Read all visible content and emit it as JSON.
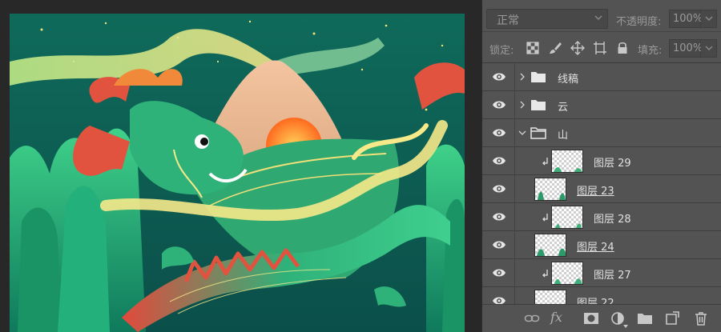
{
  "layers_panel": {
    "blend_mode": "正常",
    "opacity_label": "不透明度:",
    "opacity_value": "100%",
    "lock_label": "锁定:",
    "fill_label": "填充:",
    "fill_value": "100%",
    "fx_label": "fx",
    "layers": [
      {
        "name": "线稿",
        "kind": "group",
        "expanded": false
      },
      {
        "name": "云",
        "kind": "group",
        "expanded": false
      },
      {
        "name": "山",
        "kind": "group",
        "expanded": true
      },
      {
        "name": "图层 29",
        "kind": "layer",
        "clipped": true
      },
      {
        "name": "图层 23",
        "kind": "layer",
        "clipped": false
      },
      {
        "name": "图层 28",
        "kind": "layer",
        "clipped": true
      },
      {
        "name": "图层 24",
        "kind": "layer",
        "clipped": false
      },
      {
        "name": "图层 27",
        "kind": "layer",
        "clipped": true
      },
      {
        "name": "图层 22",
        "kind": "layer",
        "clipped": false
      }
    ]
  },
  "colors": {
    "panel_bg": "#535353",
    "canvas_bg": "#282828",
    "art_green": "#1f9a6a",
    "art_red": "#e2533f",
    "art_yellow": "#f2e07a"
  },
  "icons": [
    "eye-icon",
    "folder-icon",
    "chevron-right-icon",
    "chevron-down-icon",
    "clip-arrow-icon",
    "lock-transparent-icon",
    "brush-icon",
    "move-icon",
    "artboard-icon",
    "lock-icon",
    "link-icon",
    "mask-icon",
    "adjustment-icon",
    "new-group-icon",
    "new-layer-icon",
    "trash-icon"
  ]
}
